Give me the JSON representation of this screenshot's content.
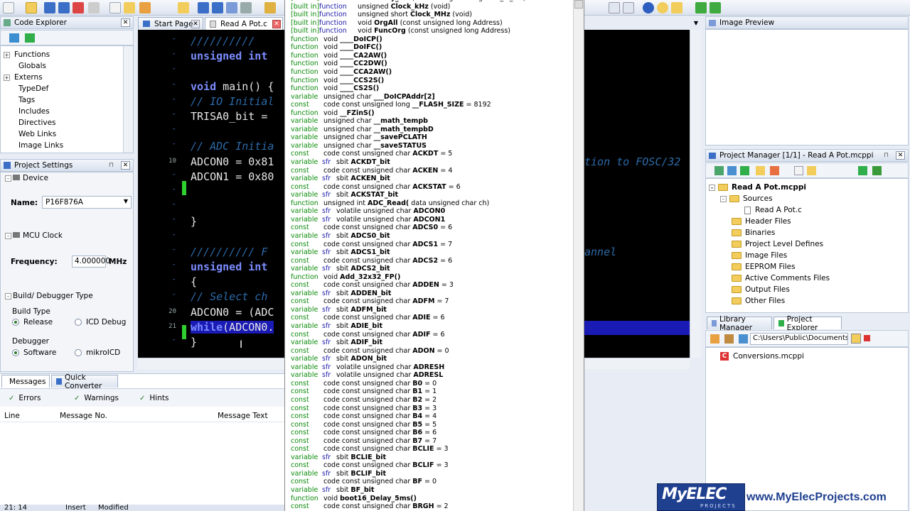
{
  "editor_tabs": [
    {
      "label": "Start Page"
    },
    {
      "label": "Read A Pot.c"
    }
  ],
  "code_explorer": {
    "title": "Code Explorer",
    "items": [
      "Functions",
      "Globals",
      "Externs",
      "TypeDef",
      "Tags",
      "Includes",
      "Directives",
      "Web Links",
      "Image Links"
    ]
  },
  "project_settings": {
    "title": "Project Settings",
    "device_section": "Device",
    "name_label": "Name:",
    "name_value": "P16F876A",
    "clock_section": "MCU Clock",
    "frequency_label": "Frequency:",
    "frequency_value": "4.000000",
    "frequency_unit": "MHz",
    "build_section": "Build/ Debugger Type",
    "build_type_label": "Build Type",
    "release_label": "Release",
    "icd_label": "ICD Debug",
    "debugger_label": "Debugger",
    "software_label": "Software",
    "mikroicd_label": "mikroICD"
  },
  "messages": {
    "tab_messages": "Messages",
    "tab_quick_converter": "Quick Converter",
    "filter_errors": "Errors",
    "filter_warnings": "Warnings",
    "filter_hints": "Hints",
    "col_line": "Line",
    "col_message_no": "Message No.",
    "col_message_text": "Message Text"
  },
  "status_bar": {
    "position": "21: 14",
    "mode": "Insert",
    "state": "Modified"
  },
  "code": {
    "line_numbers": [
      "10",
      "20",
      "21"
    ],
    "lines": [
      {
        "parts": [
          {
            "c": "cm",
            "t": "//////////"
          }
        ]
      },
      {
        "parts": [
          {
            "c": "kw",
            "t": "unsigned int"
          }
        ]
      },
      {
        "parts": []
      },
      {
        "parts": [
          {
            "c": "kw",
            "t": "void"
          },
          {
            "c": "tx",
            "t": " main() {"
          }
        ]
      },
      {
        "parts": [
          {
            "c": "cm",
            "t": "// IO Initial"
          }
        ]
      },
      {
        "parts": [
          {
            "c": "tx",
            "t": "TRISA0_bit ="
          }
        ]
      },
      {
        "parts": []
      },
      {
        "parts": [
          {
            "c": "cm",
            "t": "// ADC Initia"
          }
        ]
      },
      {
        "parts": [
          {
            "c": "tx",
            "t": "ADCON0 = 0x81"
          }
        ]
      },
      {
        "parts": [
          {
            "c": "tx",
            "t": "ADCON1 = 0x80"
          }
        ]
      },
      {
        "parts": []
      },
      {
        "parts": []
      },
      {
        "parts": [
          {
            "c": "tx",
            "t": "}"
          }
        ]
      },
      {
        "parts": []
      },
      {
        "parts": [
          {
            "c": "cm",
            "t": "////////// F"
          }
        ]
      },
      {
        "parts": [
          {
            "c": "kw",
            "t": "unsigned int"
          }
        ]
      },
      {
        "parts": [
          {
            "c": "tx",
            "t": "{"
          }
        ]
      },
      {
        "parts": [
          {
            "c": "cm",
            "t": "// Select ch"
          }
        ]
      },
      {
        "parts": [
          {
            "c": "tx",
            "t": "ADCON0 = (ADC"
          }
        ]
      },
      {
        "parts": [
          {
            "c": "kw",
            "t": "while"
          },
          {
            "c": "tx",
            "t": "(ADCON0."
          }
        ]
      },
      {
        "parts": [
          {
            "c": "tx",
            "t": "}"
          }
        ]
      }
    ],
    "overflow_comment_1": "tion to FOSC/32",
    "overflow_comment_2": "annel"
  },
  "completion_list": [
    {
      "kind": "built in",
      "role": "function",
      "type": "void",
      "name": "Delay_ms",
      "rest": "(const unsigned long time_in_ms)"
    },
    {
      "kind": "built in",
      "role": "function",
      "type": "unsigned",
      "name": "Clock_kHz",
      "rest": "(void)"
    },
    {
      "kind": "built in",
      "role": "function",
      "type": "unsigned short",
      "name": "Clock_MHz",
      "rest": "(void)"
    },
    {
      "kind": "built in",
      "role": "function",
      "type": "void",
      "name": "OrgAll",
      "rest": "(const unsigned long Address)"
    },
    {
      "kind": "built in",
      "role": "function",
      "type": "void",
      "name": "FuncOrg",
      "rest": "(const unsigned long Address)"
    },
    {
      "kind": "function",
      "role": "",
      "type": "void",
      "name": "____DoICP()",
      "rest": ""
    },
    {
      "kind": "function",
      "role": "",
      "type": "void",
      "name": "____DoIFC()",
      "rest": ""
    },
    {
      "kind": "function",
      "role": "",
      "type": "void",
      "name": "____CA2AW()",
      "rest": ""
    },
    {
      "kind": "function",
      "role": "",
      "type": "void",
      "name": "____CC2DW()",
      "rest": ""
    },
    {
      "kind": "function",
      "role": "",
      "type": "void",
      "name": "____CCA2AW()",
      "rest": ""
    },
    {
      "kind": "function",
      "role": "",
      "type": "void",
      "name": "____CCS2S()",
      "rest": ""
    },
    {
      "kind": "function",
      "role": "",
      "type": "void",
      "name": "____CS2S()",
      "rest": ""
    },
    {
      "kind": "variable",
      "role": "",
      "type": "unsigned char",
      "name": "___DoICPAddr[2]",
      "rest": ""
    },
    {
      "kind": "const",
      "role": "",
      "type": "code const unsigned long",
      "name": "__FLASH_SIZE",
      "rest": "= 8192"
    },
    {
      "kind": "function",
      "role": "",
      "type": "void",
      "name": "__FZinS()",
      "rest": ""
    },
    {
      "kind": "variable",
      "role": "",
      "type": "unsigned char",
      "name": "__math_tempb",
      "rest": ""
    },
    {
      "kind": "variable",
      "role": "",
      "type": "unsigned char",
      "name": "__math_tempbD",
      "rest": ""
    },
    {
      "kind": "variable",
      "role": "",
      "type": "unsigned char",
      "name": "__savePCLATH",
      "rest": ""
    },
    {
      "kind": "variable",
      "role": "",
      "type": "unsigned char",
      "name": "__saveSTATUS",
      "rest": ""
    },
    {
      "kind": "const",
      "role": "",
      "type": "code const unsigned char",
      "name": "ACKDT",
      "rest": "= 5"
    },
    {
      "kind": "variable",
      "role": "sfr",
      "type": "sbit",
      "name": "ACKDT_bit",
      "rest": ""
    },
    {
      "kind": "const",
      "role": "",
      "type": "code const unsigned char",
      "name": "ACKEN",
      "rest": "= 4"
    },
    {
      "kind": "variable",
      "role": "sfr",
      "type": "sbit",
      "name": "ACKEN_bit",
      "rest": ""
    },
    {
      "kind": "const",
      "role": "",
      "type": "code const unsigned char",
      "name": "ACKSTAT",
      "rest": "= 6"
    },
    {
      "kind": "variable",
      "role": "sfr",
      "type": "sbit",
      "name": "ACKSTAT_bit",
      "rest": ""
    },
    {
      "kind": "function",
      "role": "",
      "type": "unsigned int",
      "name": "ADC_Read(",
      "rest": "data unsigned char ch)"
    },
    {
      "kind": "variable",
      "role": "sfr",
      "type": "volatile unsigned char",
      "name": "ADCON0",
      "rest": ""
    },
    {
      "kind": "variable",
      "role": "sfr",
      "type": "volatile unsigned char",
      "name": "ADCON1",
      "rest": ""
    },
    {
      "kind": "const",
      "role": "",
      "type": "code const unsigned char",
      "name": "ADCS0",
      "rest": "= 6"
    },
    {
      "kind": "variable",
      "role": "sfr",
      "type": "sbit",
      "name": "ADCS0_bit",
      "rest": ""
    },
    {
      "kind": "const",
      "role": "",
      "type": "code const unsigned char",
      "name": "ADCS1",
      "rest": "= 7"
    },
    {
      "kind": "variable",
      "role": "sfr",
      "type": "sbit",
      "name": "ADCS1_bit",
      "rest": ""
    },
    {
      "kind": "const",
      "role": "",
      "type": "code const unsigned char",
      "name": "ADCS2",
      "rest": "= 6"
    },
    {
      "kind": "variable",
      "role": "sfr",
      "type": "sbit",
      "name": "ADCS2_bit",
      "rest": ""
    },
    {
      "kind": "function",
      "role": "",
      "type": "void",
      "name": "Add_32x32_FP()",
      "rest": ""
    },
    {
      "kind": "const",
      "role": "",
      "type": "code const unsigned char",
      "name": "ADDEN",
      "rest": "= 3"
    },
    {
      "kind": "variable",
      "role": "sfr",
      "type": "sbit",
      "name": "ADDEN_bit",
      "rest": ""
    },
    {
      "kind": "const",
      "role": "",
      "type": "code const unsigned char",
      "name": "ADFM",
      "rest": "= 7"
    },
    {
      "kind": "variable",
      "role": "sfr",
      "type": "sbit",
      "name": "ADFM_bit",
      "rest": ""
    },
    {
      "kind": "const",
      "role": "",
      "type": "code const unsigned char",
      "name": "ADIE",
      "rest": "= 6"
    },
    {
      "kind": "variable",
      "role": "sfr",
      "type": "sbit",
      "name": "ADIE_bit",
      "rest": ""
    },
    {
      "kind": "const",
      "role": "",
      "type": "code const unsigned char",
      "name": "ADIF",
      "rest": "= 6"
    },
    {
      "kind": "variable",
      "role": "sfr",
      "type": "sbit",
      "name": "ADIF_bit",
      "rest": ""
    },
    {
      "kind": "const",
      "role": "",
      "type": "code const unsigned char",
      "name": "ADON",
      "rest": "= 0"
    },
    {
      "kind": "variable",
      "role": "sfr",
      "type": "sbit",
      "name": "ADON_bit",
      "rest": ""
    },
    {
      "kind": "variable",
      "role": "sfr",
      "type": "volatile unsigned char",
      "name": "ADRESH",
      "rest": ""
    },
    {
      "kind": "variable",
      "role": "sfr",
      "type": "volatile unsigned char",
      "name": "ADRESL",
      "rest": ""
    },
    {
      "kind": "const",
      "role": "",
      "type": "code const unsigned char",
      "name": "B0",
      "rest": "= 0"
    },
    {
      "kind": "const",
      "role": "",
      "type": "code const unsigned char",
      "name": "B1",
      "rest": "= 1"
    },
    {
      "kind": "const",
      "role": "",
      "type": "code const unsigned char",
      "name": "B2",
      "rest": "= 2"
    },
    {
      "kind": "const",
      "role": "",
      "type": "code const unsigned char",
      "name": "B3",
      "rest": "= 3"
    },
    {
      "kind": "const",
      "role": "",
      "type": "code const unsigned char",
      "name": "B4",
      "rest": "= 4"
    },
    {
      "kind": "const",
      "role": "",
      "type": "code const unsigned char",
      "name": "B5",
      "rest": "= 5"
    },
    {
      "kind": "const",
      "role": "",
      "type": "code const unsigned char",
      "name": "B6",
      "rest": "= 6"
    },
    {
      "kind": "const",
      "role": "",
      "type": "code const unsigned char",
      "name": "B7",
      "rest": "= 7"
    },
    {
      "kind": "const",
      "role": "",
      "type": "code const unsigned char",
      "name": "BCLIE",
      "rest": "= 3"
    },
    {
      "kind": "variable",
      "role": "sfr",
      "type": "sbit",
      "name": "BCLIE_bit",
      "rest": ""
    },
    {
      "kind": "const",
      "role": "",
      "type": "code const unsigned char",
      "name": "BCLIF",
      "rest": "= 3"
    },
    {
      "kind": "variable",
      "role": "sfr",
      "type": "sbit",
      "name": "BCLIF_bit",
      "rest": ""
    },
    {
      "kind": "const",
      "role": "",
      "type": "code const unsigned char",
      "name": "BF",
      "rest": "= 0"
    },
    {
      "kind": "variable",
      "role": "sfr",
      "type": "sbit",
      "name": "BF_bit",
      "rest": ""
    },
    {
      "kind": "function",
      "role": "",
      "type": "void",
      "name": "boot16_Delay_5ms()",
      "rest": ""
    },
    {
      "kind": "const",
      "role": "",
      "type": "code const unsigned char",
      "name": "BRGH",
      "rest": "= 2"
    }
  ],
  "image_preview": {
    "title": "Image Preview"
  },
  "project_manager": {
    "title": "Project Manager [1/1] - Read A Pot.mcppi",
    "root": "Read A Pot.mcppi",
    "folders": [
      "Sources",
      "Header Files",
      "Binaries",
      "Project Level Defines",
      "Image Files",
      "EEPROM Files",
      "Active Comments Files",
      "Output Files",
      "Other Files"
    ],
    "source_file": "Read A Pot.c"
  },
  "explorer_tabs": {
    "library_manager": "Library Manager",
    "project_explorer": "Project Explorer"
  },
  "project_explorer": {
    "path": "C:\\Users\\Public\\Documents\\Mil",
    "file": "Conversions.mcppi"
  },
  "watermark": {
    "logo_text": "MyELEC",
    "logo_sub": "PROJECTS",
    "url": "www.MyElecProjects.com"
  },
  "colors": {
    "accent": "#1f3f8f",
    "editor_bg": "#000000",
    "keyword": "#7b8cff",
    "comment": "#2c6aa8",
    "gutter_bar": "#2fd02f"
  }
}
